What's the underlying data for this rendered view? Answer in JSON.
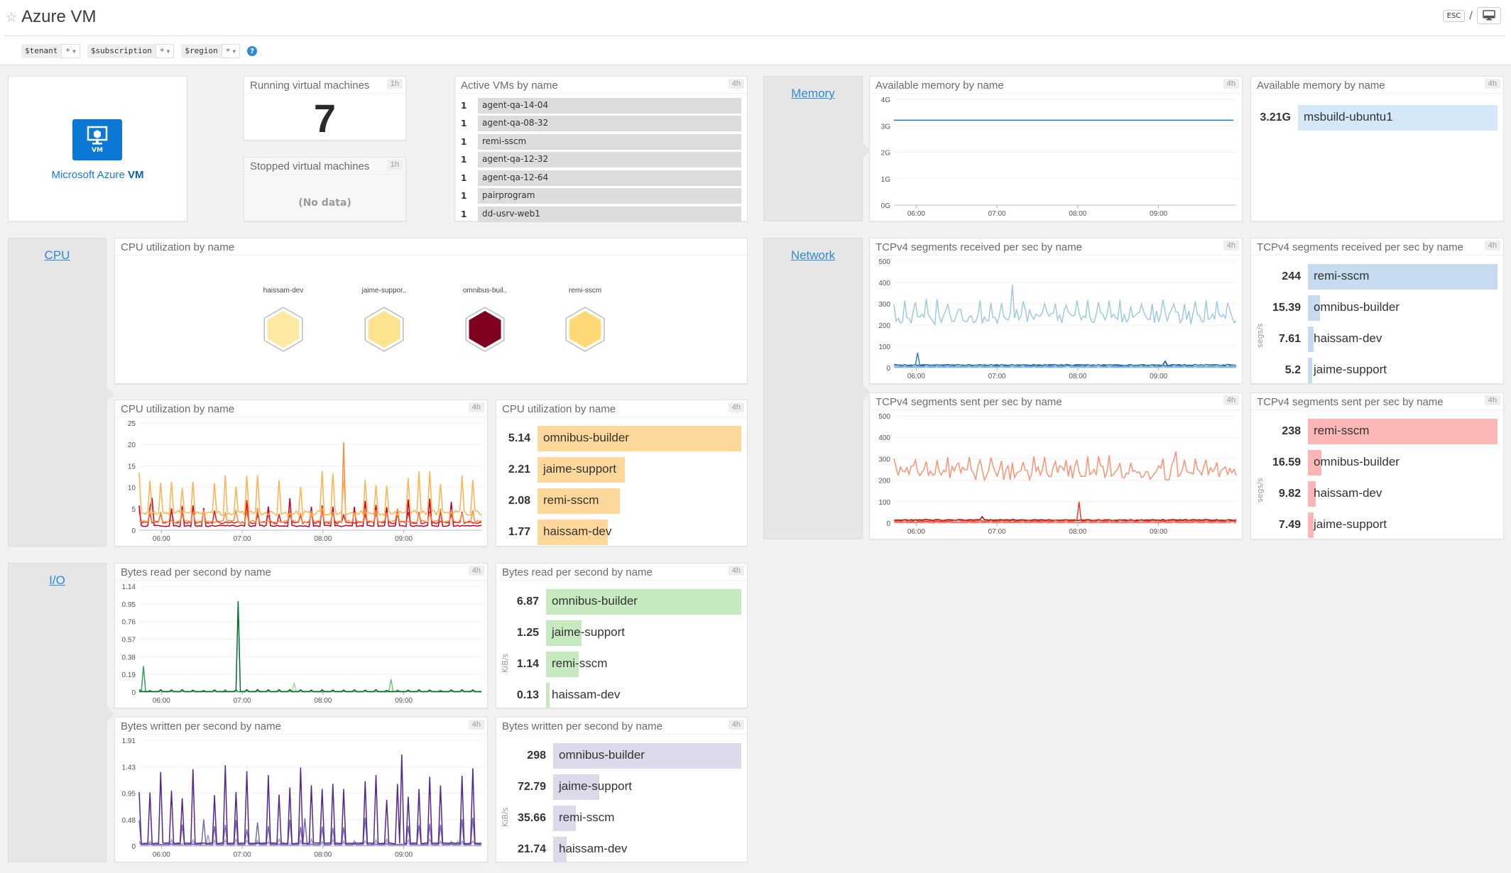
{
  "header": {
    "title": "Azure VM",
    "template_vars": [
      {
        "name": "$tenant",
        "value": "*"
      },
      {
        "name": "$subscription",
        "value": "*"
      },
      {
        "name": "$region",
        "value": "*"
      }
    ],
    "help": "?",
    "esc_label": "ESC",
    "separator": "/"
  },
  "logo": {
    "tile_label": "VM",
    "text_light": "Microsoft Azure ",
    "text_bold": "VM"
  },
  "running_vms": {
    "title": "Running virtual machines",
    "badge": "1h",
    "value": "7"
  },
  "stopped_vms": {
    "title": "Stopped virtual machines",
    "badge": "1h",
    "value": "(No data)"
  },
  "active_vms": {
    "title": "Active VMs by name",
    "badge": "4h",
    "rows": [
      {
        "count": "1",
        "name": "agent-qa-14-04"
      },
      {
        "count": "1",
        "name": "agent-qa-08-32"
      },
      {
        "count": "1",
        "name": "remi-sscm"
      },
      {
        "count": "1",
        "name": "agent-qa-12-32"
      },
      {
        "count": "1",
        "name": "agent-qa-12-64"
      },
      {
        "count": "1",
        "name": "pairprogram"
      },
      {
        "count": "1",
        "name": "dd-usrv-web1"
      }
    ]
  },
  "sections": {
    "memory": "Memory",
    "cpu": "CPU",
    "network": "Network",
    "io": "I/O"
  },
  "colors": {
    "link": "#2d8ad6",
    "memory_line": "#1f78b4",
    "memory_bar": "#d6e8f7",
    "cpu_bar": "#fdd89a",
    "net_rx_bar": "#c6dbef",
    "net_tx_bar": "#fcb6b6",
    "io_read_bar": "#c7e9c0",
    "io_write_bar": "#dadaeb"
  },
  "chart_data": [
    {
      "id": "mem_ts",
      "type": "line",
      "title": "Available memory by name",
      "badge": "4h",
      "xlabel": "",
      "ylabel": "",
      "x_ticks": [
        "06:00",
        "07:00",
        "08:00",
        "09:00"
      ],
      "y_ticks": [
        "0G",
        "1G",
        "2G",
        "3G",
        "4G"
      ],
      "ylim": [
        0,
        4
      ],
      "series": [
        {
          "name": "msbuild-ubuntu1",
          "color": "#1f78b4",
          "values": [
            3.21,
            3.21
          ]
        }
      ]
    },
    {
      "id": "mem_top",
      "type": "bar",
      "title": "Available memory by name",
      "badge": "4h",
      "unit": "",
      "categories": [
        "msbuild-ubuntu1"
      ],
      "values": [
        3.21
      ],
      "labels": [
        "3.21G"
      ],
      "color": "#d6e8f7"
    },
    {
      "id": "cpu_hex",
      "type": "heatmap",
      "title": "CPU utilization by name",
      "categories": [
        "haissam-dev",
        "jaime-suppor..",
        "omnibus-buil..",
        "remi-sscm"
      ],
      "values": [
        1.77,
        2.21,
        5.14,
        2.08
      ],
      "colors": [
        "#fde9a3",
        "#fde38f",
        "#800020",
        "#fed976"
      ]
    },
    {
      "id": "cpu_ts",
      "type": "line",
      "title": "CPU utilization by name",
      "badge": "4h",
      "x_ticks": [
        "06:00",
        "07:00",
        "08:00",
        "09:00"
      ],
      "y_ticks": [
        "0",
        "5",
        "10",
        "15",
        "20",
        "25"
      ],
      "ylim": [
        0,
        25
      ],
      "series": [
        {
          "name": "omnibus-builder",
          "color": "#feb24c",
          "base": 4,
          "spike": 9,
          "peak": 10.8
        },
        {
          "name": "jaime-support",
          "color": "#fd8d3c",
          "base": 2,
          "spike": 3,
          "peak": 20.5
        },
        {
          "name": "remi-sscm",
          "color": "#e31a1c",
          "base": 1.8,
          "spike": 2.8,
          "peak": 7
        },
        {
          "name": "haissam-dev",
          "color": "#bd0026",
          "base": 1,
          "spike": 6,
          "peak": 7.5
        }
      ]
    },
    {
      "id": "cpu_top",
      "type": "bar",
      "title": "CPU utilization by name",
      "badge": "4h",
      "unit": "",
      "categories": [
        "omnibus-builder",
        "jaime-support",
        "remi-sscm",
        "haissam-dev"
      ],
      "values": [
        5.14,
        2.21,
        2.08,
        1.77
      ],
      "labels": [
        "5.14",
        "2.21",
        "2.08",
        "1.77"
      ],
      "color": "#fdd89a"
    },
    {
      "id": "net_rx_ts",
      "type": "line",
      "title": "TCPv4 segments received per sec by name",
      "badge": "4h",
      "x_ticks": [
        "06:00",
        "07:00",
        "08:00",
        "09:00"
      ],
      "y_ticks": [
        "0",
        "100",
        "200",
        "300",
        "400",
        "500"
      ],
      "ylim": [
        0,
        500
      ],
      "series": [
        {
          "name": "remi-sscm",
          "color": "#9ecae1",
          "base": 240,
          "spike": 80,
          "peak": 390
        },
        {
          "name": "omnibus-builder",
          "color": "#3182bd",
          "base": 10,
          "spike": 5,
          "peak": 70
        },
        {
          "name": "haissam-dev",
          "color": "#08519c",
          "base": 12,
          "spike": 3,
          "peak": 30
        },
        {
          "name": "jaime-support",
          "color": "#6baed6",
          "base": 4,
          "spike": 2,
          "peak": 10
        }
      ]
    },
    {
      "id": "net_rx_top",
      "type": "bar",
      "title": "TCPv4 segments received per sec by name",
      "badge": "4h",
      "unit": "segs/s",
      "categories": [
        "remi-sscm",
        "omnibus-builder",
        "haissam-dev",
        "jaime-support"
      ],
      "values": [
        244,
        15.39,
        7.61,
        5.2
      ],
      "labels": [
        "244",
        "15.39",
        "7.61",
        "5.2"
      ],
      "color": "#c6dbef"
    },
    {
      "id": "net_tx_ts",
      "type": "line",
      "title": "TCPv4 segments sent per sec by name",
      "badge": "4h",
      "x_ticks": [
        "06:00",
        "07:00",
        "08:00",
        "09:00"
      ],
      "y_ticks": [
        "0",
        "100",
        "200",
        "300",
        "400",
        "500"
      ],
      "ylim": [
        0,
        500
      ],
      "series": [
        {
          "name": "remi-sscm",
          "color": "#fc9272",
          "base": 235,
          "spike": 75,
          "peak": 335
        },
        {
          "name": "omnibus-builder",
          "color": "#ef3b2c",
          "base": 10,
          "spike": 5,
          "peak": 100
        },
        {
          "name": "haissam-dev",
          "color": "#a50f15",
          "base": 14,
          "spike": 3,
          "peak": 30
        },
        {
          "name": "jaime-support",
          "color": "#fb6a4a",
          "base": 4,
          "spike": 2,
          "peak": 10
        }
      ]
    },
    {
      "id": "net_tx_top",
      "type": "bar",
      "title": "TCPv4 segments sent per sec by name",
      "badge": "4h",
      "unit": "segs/s",
      "categories": [
        "remi-sscm",
        "omnibus-builder",
        "haissam-dev",
        "jaime-support"
      ],
      "values": [
        238,
        16.59,
        9.82,
        7.49
      ],
      "labels": [
        "238",
        "16.59",
        "9.82",
        "7.49"
      ],
      "color": "#fcb6b6"
    },
    {
      "id": "io_read_ts",
      "type": "line",
      "title": "Bytes read per second by name",
      "badge": "4h",
      "x_ticks": [
        "06:00",
        "07:00",
        "08:00",
        "09:00"
      ],
      "y_ticks": [
        "0",
        "0.19",
        "0.38",
        "0.57",
        "0.76",
        "0.95",
        "1.14"
      ],
      "ylim": [
        0,
        1.14
      ],
      "series": [
        {
          "name": "omnibus-builder",
          "color": "#006d2c",
          "base": 0.005,
          "spike": 0.02,
          "peak": 0.98
        },
        {
          "name": "jaime-support",
          "color": "#31a354",
          "base": 0.003,
          "spike": 0.02,
          "peak": 0.28
        },
        {
          "name": "remi-sscm",
          "color": "#74c476",
          "base": 0.003,
          "spike": 0.01,
          "peak": 0.14
        },
        {
          "name": "haissam-dev",
          "color": "#a1d99b",
          "base": 0.002,
          "spike": 0.01,
          "peak": 0.1
        }
      ]
    },
    {
      "id": "io_read_top",
      "type": "bar",
      "title": "Bytes read per second by name",
      "badge": "4h",
      "unit": "KiB/s",
      "categories": [
        "omnibus-builder",
        "jaime-support",
        "remi-sscm",
        "haissam-dev"
      ],
      "values": [
        6.87,
        1.25,
        1.14,
        0.13
      ],
      "labels": [
        "6.87",
        "1.25",
        "1.14",
        "0.13"
      ],
      "color": "#c7e9c0"
    },
    {
      "id": "io_write_ts",
      "type": "line",
      "title": "Bytes written per second by name",
      "badge": "4h",
      "x_ticks": [
        "06:00",
        "07:00",
        "08:00",
        "09:00"
      ],
      "y_ticks": [
        "0",
        "0.48",
        "0.95",
        "1.43",
        "1.91"
      ],
      "ylim": [
        0,
        1.91
      ],
      "series": [
        {
          "name": "omnibus-builder",
          "color": "#54278f",
          "base": 0.05,
          "spike": 1.3,
          "peak": 1.65
        },
        {
          "name": "jaime-support",
          "color": "#756bb1",
          "base": 0.03,
          "spike": 0.45,
          "peak": 0.5
        },
        {
          "name": "remi-sscm",
          "color": "#9e9ac8",
          "base": 0.02,
          "spike": 0.1,
          "peak": 0.2
        },
        {
          "name": "haissam-dev",
          "color": "#bcbddc",
          "base": 0.01,
          "spike": 0.05,
          "peak": 0.1
        }
      ]
    },
    {
      "id": "io_write_top",
      "type": "bar",
      "title": "Bytes written per second by name",
      "badge": "4h",
      "unit": "KiB/s",
      "categories": [
        "omnibus-builder",
        "jaime-support",
        "remi-sscm",
        "haissam-dev"
      ],
      "values": [
        298,
        72.79,
        35.66,
        21.74
      ],
      "labels": [
        "298",
        "72.79",
        "35.66",
        "21.74"
      ],
      "color": "#dadaeb"
    }
  ]
}
